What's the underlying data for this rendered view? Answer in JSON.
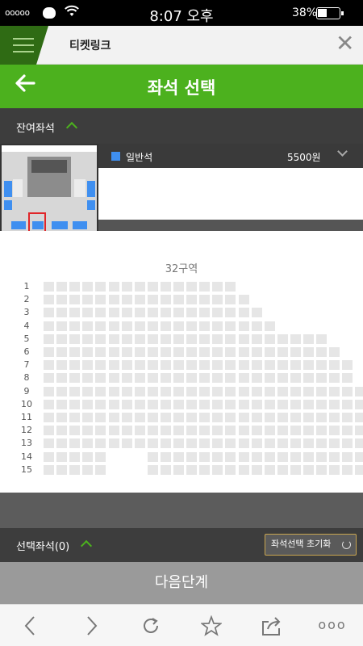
{
  "status_bar": {
    "signal": "ooooo",
    "time": "8:07 오후",
    "battery_pct": "38%",
    "icons": [
      "signal-dots-icon",
      "cat-icon",
      "wifi-icon",
      "battery-icon"
    ]
  },
  "browser_tab": {
    "title": "티켓링크",
    "close_icon": "close-icon",
    "menu_icon": "hamburger-icon"
  },
  "header": {
    "title": "좌석 선택",
    "back_icon": "arrow-left-icon"
  },
  "remaining": {
    "label": "잔여좌석",
    "toggle_icon": "chevron-up-icon"
  },
  "grade": {
    "name": "일반석",
    "price": "5500원",
    "color": "#3f8ff0",
    "toggle_icon": "chevron-down-icon"
  },
  "zone": {
    "title": "32구역",
    "rows": [
      {
        "label": "1",
        "seats": [
          1,
          1,
          1,
          1,
          1,
          1,
          1,
          1,
          1,
          1,
          1,
          1,
          1,
          1,
          1
        ]
      },
      {
        "label": "2",
        "seats": [
          1,
          1,
          1,
          1,
          1,
          1,
          1,
          1,
          1,
          1,
          1,
          1,
          1,
          1,
          1,
          1
        ]
      },
      {
        "label": "3",
        "seats": [
          1,
          1,
          1,
          1,
          1,
          1,
          1,
          1,
          1,
          1,
          1,
          1,
          1,
          1,
          1,
          1,
          1
        ]
      },
      {
        "label": "4",
        "seats": [
          1,
          1,
          1,
          1,
          1,
          1,
          1,
          1,
          1,
          1,
          1,
          1,
          1,
          1,
          1,
          1,
          1,
          1
        ]
      },
      {
        "label": "5",
        "seats": [
          1,
          1,
          1,
          1,
          1,
          1,
          1,
          1,
          1,
          1,
          1,
          1,
          1,
          1,
          1,
          1,
          1,
          1,
          1,
          1,
          1,
          1
        ]
      },
      {
        "label": "6",
        "seats": [
          1,
          1,
          1,
          1,
          1,
          1,
          1,
          1,
          1,
          1,
          1,
          1,
          1,
          1,
          1,
          1,
          1,
          1,
          1,
          1,
          1,
          1,
          1
        ]
      },
      {
        "label": "7",
        "seats": [
          1,
          1,
          1,
          1,
          1,
          1,
          1,
          1,
          1,
          1,
          1,
          1,
          1,
          1,
          1,
          1,
          1,
          1,
          1,
          1,
          1,
          1,
          1,
          1
        ]
      },
      {
        "label": "8",
        "seats": [
          1,
          1,
          1,
          1,
          1,
          1,
          1,
          1,
          1,
          1,
          1,
          1,
          1,
          1,
          1,
          1,
          1,
          1,
          1,
          1,
          1,
          1,
          1,
          1
        ]
      },
      {
        "label": "9",
        "seats": [
          1,
          1,
          1,
          1,
          1,
          1,
          1,
          1,
          1,
          1,
          1,
          1,
          1,
          1,
          1,
          1,
          1,
          1,
          1,
          1,
          1,
          1,
          1,
          1,
          1
        ]
      },
      {
        "label": "10",
        "seats": [
          1,
          1,
          1,
          1,
          1,
          1,
          1,
          1,
          1,
          1,
          1,
          1,
          1,
          1,
          1,
          1,
          1,
          1,
          1,
          1,
          1,
          1,
          1,
          1,
          1
        ]
      },
      {
        "label": "11",
        "seats": [
          1,
          1,
          1,
          1,
          1,
          1,
          1,
          1,
          1,
          1,
          1,
          1,
          1,
          1,
          1,
          1,
          1,
          1,
          1,
          1,
          1,
          1,
          1,
          1,
          1
        ]
      },
      {
        "label": "12",
        "seats": [
          1,
          1,
          1,
          1,
          1,
          1,
          1,
          1,
          1,
          1,
          1,
          1,
          1,
          1,
          1,
          1,
          1,
          1,
          1,
          1,
          1,
          1,
          1,
          1,
          1
        ]
      },
      {
        "label": "13",
        "seats": [
          1,
          1,
          1,
          1,
          1,
          1,
          1,
          1,
          1,
          1,
          1,
          1,
          1,
          1,
          1,
          1,
          1,
          1,
          1,
          1,
          1,
          1,
          1,
          1,
          1
        ]
      },
      {
        "label": "14",
        "seats": [
          1,
          1,
          1,
          1,
          1,
          0,
          0,
          0,
          1,
          1,
          1,
          1,
          1,
          1,
          1,
          1,
          1,
          1,
          1,
          1,
          1,
          1,
          1,
          1,
          1
        ]
      },
      {
        "label": "15",
        "seats": [
          1,
          1,
          1,
          1,
          1,
          0,
          0,
          0,
          1,
          1,
          1,
          1,
          1,
          1,
          1,
          1,
          1,
          1,
          1,
          1,
          1,
          1,
          1,
          1,
          1
        ]
      }
    ]
  },
  "selected": {
    "label": "선택좌석(0)",
    "toggle_icon": "chevron-up-icon",
    "reset_label": "좌석선택 초기화",
    "reset_icon": "refresh-icon"
  },
  "next_button": {
    "label": "다음단계"
  },
  "toolbar": {
    "back_icon": "chevron-left-icon",
    "forward_icon": "chevron-right-icon",
    "reload_icon": "reload-icon",
    "bookmark_icon": "star-icon",
    "share_icon": "share-icon",
    "more_icon": "more-icon"
  },
  "colors": {
    "accent_green": "#4cb11e",
    "dark_bar": "#3d3d3d",
    "seat_available": "#e6e6e6",
    "reset_border": "#c9a550"
  }
}
